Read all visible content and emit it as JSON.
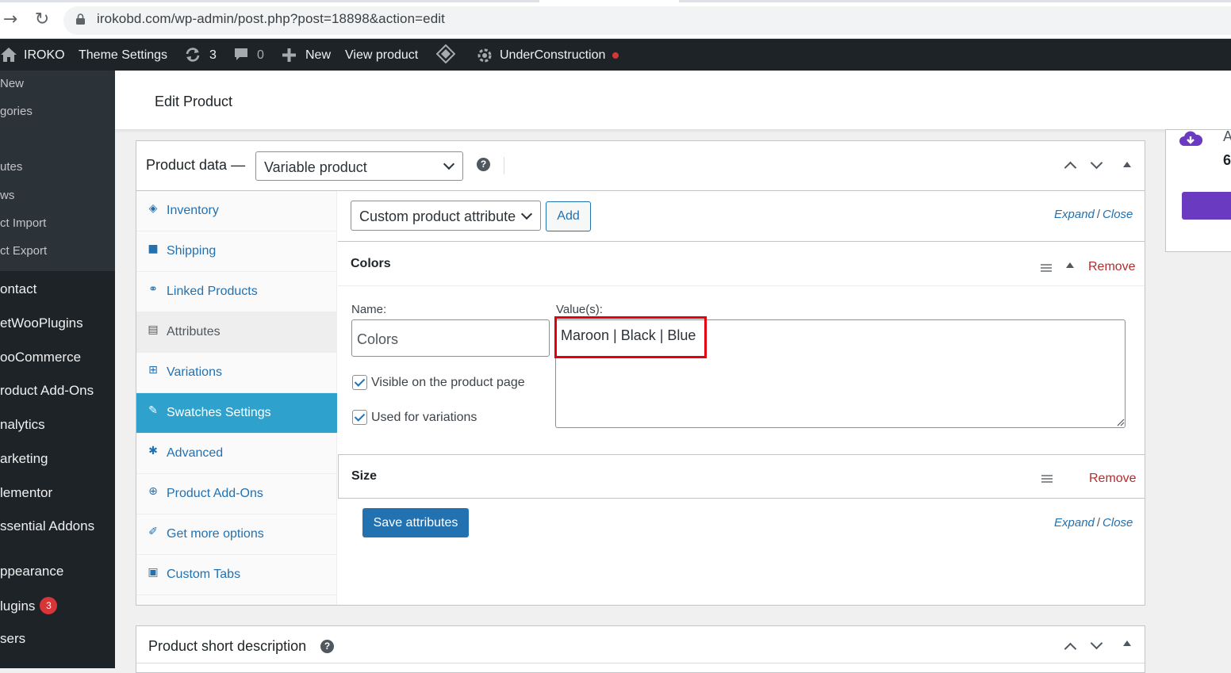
{
  "browser": {
    "url": "irokobd.com/wp-admin/post.php?post=18898&action=edit"
  },
  "adminbar": {
    "site_name": "IROKO",
    "theme_settings": "Theme Settings",
    "updates_count": "3",
    "comments_count": "0",
    "new_label": "New",
    "view_product": "View product",
    "under_construction": "UnderConstruction"
  },
  "sidebar": {
    "sub_items": [
      "New",
      "gories",
      "utes",
      "ws",
      "ct Import",
      "ct Export"
    ],
    "main_items": [
      "ontact",
      "etWooPlugins",
      "ooCommerce",
      "roduct Add-Ons",
      "nalytics",
      "arketing",
      "lementor",
      "ssential Addons",
      "ppearance",
      "lugins",
      "sers"
    ],
    "plugins_badge": "3"
  },
  "header": {
    "title": "Edit Product"
  },
  "rightbox": {
    "text_a": "A",
    "text_6": "6"
  },
  "product_data": {
    "label": "Product data —",
    "type_selected": "Variable product",
    "tabs": [
      {
        "label": "Inventory",
        "icon": "tag-icon"
      },
      {
        "label": "Shipping",
        "icon": "truck-icon"
      },
      {
        "label": "Linked Products",
        "icon": "link-icon"
      },
      {
        "label": "Attributes",
        "icon": "list-icon"
      },
      {
        "label": "Variations",
        "icon": "grid-icon"
      },
      {
        "label": "Swatches Settings",
        "icon": "wrench-icon"
      },
      {
        "label": "Advanced",
        "icon": "gear-icon"
      },
      {
        "label": "Product Add-Ons",
        "icon": "plus-circle-icon"
      },
      {
        "label": "Get more options",
        "icon": "plug-icon"
      },
      {
        "label": "Custom Tabs",
        "icon": "tabs-icon"
      }
    ],
    "attribute_select": "Custom product attribute",
    "add_button": "Add",
    "expand": "Expand",
    "slash": "/",
    "close": "Close",
    "attributes": [
      {
        "title": "Colors",
        "remove": "Remove",
        "name_label": "Name:",
        "name_value": "Colors",
        "values_label": "Value(s):",
        "values_value": "Maroon | Black | Blue",
        "visible_label": "Visible on the product page",
        "variations_label": "Used for variations"
      },
      {
        "title": "Size",
        "remove": "Remove"
      }
    ],
    "save_button": "Save attributes"
  },
  "short_description": {
    "label": "Product short description"
  },
  "colors": {
    "admin_bg": "#1d2327",
    "link": "#2271b1",
    "active_tab": "#2ea2cc",
    "remove": "#b32d2e",
    "highlight": "#e3000f",
    "status_dot": "#d63638"
  }
}
